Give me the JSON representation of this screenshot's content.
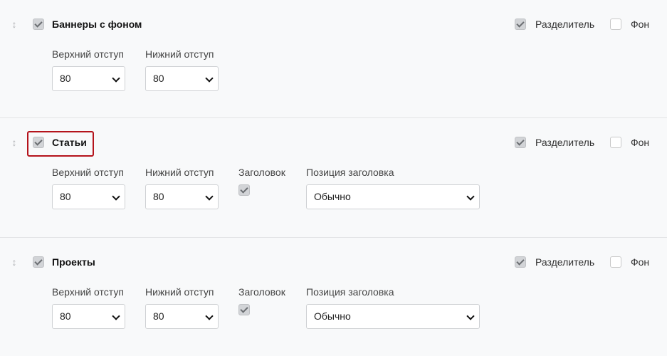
{
  "sections": [
    {
      "title": "Баннеры с фоном",
      "enabled": true,
      "divider_label": "Разделитель",
      "divider_checked": true,
      "bg_label": "Фон",
      "bg_checked": false,
      "top_padding_label": "Верхний отступ",
      "top_padding_value": "80",
      "bottom_padding_label": "Нижний отступ",
      "bottom_padding_value": "80"
    },
    {
      "title": "Статьи",
      "enabled": true,
      "divider_label": "Разделитель",
      "divider_checked": true,
      "bg_label": "Фон",
      "bg_checked": false,
      "top_padding_label": "Верхний отступ",
      "top_padding_value": "80",
      "bottom_padding_label": "Нижний отступ",
      "bottom_padding_value": "80",
      "heading_label": "Заголовок",
      "heading_checked": true,
      "heading_position_label": "Позиция заголовка",
      "heading_position_value": "Обычно"
    },
    {
      "title": "Проекты",
      "enabled": true,
      "divider_label": "Разделитель",
      "divider_checked": true,
      "bg_label": "Фон",
      "bg_checked": false,
      "top_padding_label": "Верхний отступ",
      "top_padding_value": "80",
      "bottom_padding_label": "Нижний отступ",
      "bottom_padding_value": "80",
      "heading_label": "Заголовок",
      "heading_checked": true,
      "heading_position_label": "Позиция заголовка",
      "heading_position_value": "Обычно"
    }
  ],
  "colors": {
    "highlight": "#b4131b",
    "background": "#f8f9fa"
  }
}
